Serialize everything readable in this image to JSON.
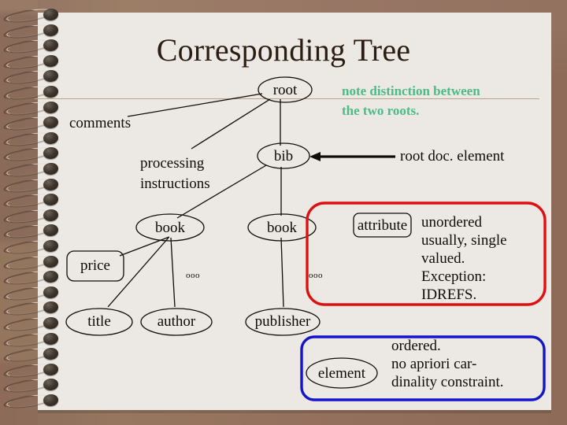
{
  "slide": {
    "title": "Corresponding Tree",
    "background_color": "#93735f",
    "paper_color": "#ece8e3",
    "rule_color": "#b9a483",
    "title_color": "#2b1d12"
  },
  "annotations": {
    "note": {
      "line1": "note distinction between",
      "line2": "the two roots.",
      "color": "#4cbb87"
    },
    "root_doc_element": "root doc. element"
  },
  "tree": {
    "labels": {
      "comments": "comments",
      "processing_line1": "processing",
      "processing_line2": "instructions"
    },
    "nodes": [
      {
        "id": "root",
        "label": "root",
        "shape": "ellipse"
      },
      {
        "id": "bib",
        "label": "bib",
        "shape": "ellipse"
      },
      {
        "id": "book_left",
        "label": "book",
        "shape": "ellipse"
      },
      {
        "id": "book_right",
        "label": "book",
        "shape": "ellipse"
      },
      {
        "id": "price",
        "label": "price",
        "shape": "rounded-rect"
      },
      {
        "id": "title",
        "label": "title",
        "shape": "ellipse"
      },
      {
        "id": "author",
        "label": "author",
        "shape": "ellipse"
      },
      {
        "id": "publisher",
        "label": "publisher",
        "shape": "ellipse"
      }
    ],
    "ellipsis_marks": [
      "ooo",
      "ooo"
    ]
  },
  "legend": {
    "attribute": {
      "key_label": "attribute",
      "key_shape": "rounded-rect",
      "border_color": "#dd1111",
      "lines": [
        "unordered",
        "usually, single",
        "valued.",
        "Exception:",
        "IDREFS."
      ]
    },
    "element": {
      "key_label": "element",
      "key_shape": "ellipse",
      "border_color": "#1414c8",
      "lines": [
        "ordered.",
        "no apriori car-",
        "dinality constraint."
      ]
    }
  }
}
